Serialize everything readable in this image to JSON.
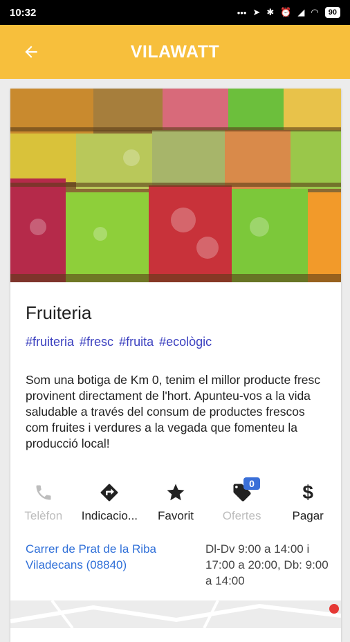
{
  "status_bar": {
    "time": "10:32",
    "battery": "90"
  },
  "app_bar": {
    "title": "VILAWATT"
  },
  "shop": {
    "name": "Fruiteria",
    "tags": [
      "#fruiteria",
      "#fresc",
      "#fruita",
      "#ecològic"
    ],
    "description": "Som una botiga de Km 0, tenim el millor producte fresc provinent directament de l'hort. Apunteu-vos a la vida saludable a través del consum de productes frescos com fruites i verdures a la vegada que fomenteu la producció local!"
  },
  "actions": [
    {
      "label": "Telèfon",
      "icon": "phone-icon",
      "enabled": false
    },
    {
      "label": "Indicacio...",
      "icon": "directions-icon",
      "enabled": true
    },
    {
      "label": "Favorit",
      "icon": "star-icon",
      "enabled": true
    },
    {
      "label": "Ofertes",
      "icon": "tag-icon",
      "enabled": false,
      "badge": "0"
    },
    {
      "label": "Pagar",
      "icon": "dollar-icon",
      "enabled": true
    }
  ],
  "address": "Carrer de Prat de la Riba Viladecans (08840)",
  "hours": "Dl-Dv 9:00 a 14:00 i 17:00 a 20:00, Db: 9:00 a 14:00",
  "colors": {
    "accent": "#f7bf3c",
    "link": "#2f6fd8",
    "tag": "#3a3fbf",
    "badge": "#3a6fd8"
  }
}
